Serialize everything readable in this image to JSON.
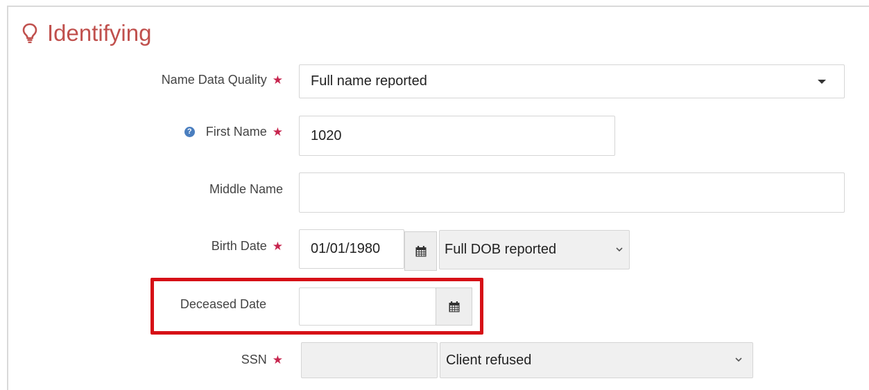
{
  "section": {
    "title": "Identifying",
    "icon": "lightbulb-icon"
  },
  "fields": {
    "name_quality": {
      "label": "Name Data Quality",
      "value": "Full name reported",
      "required": "★"
    },
    "first_name": {
      "label": "First Name",
      "value": "1020",
      "required": "★",
      "help": "?"
    },
    "middle_name": {
      "label": "Middle Name",
      "value": ""
    },
    "birth_date": {
      "label": "Birth Date",
      "value": "01/01/1980",
      "required": "★",
      "quality": "Full DOB reported"
    },
    "deceased_date": {
      "label": "Deceased Date",
      "value": ""
    },
    "ssn": {
      "label": "SSN",
      "value": "",
      "required": "★",
      "quality": "Client refused"
    }
  },
  "colors": {
    "heading": "#c0504d",
    "required": "#c7254e",
    "highlight": "#d60f16"
  }
}
